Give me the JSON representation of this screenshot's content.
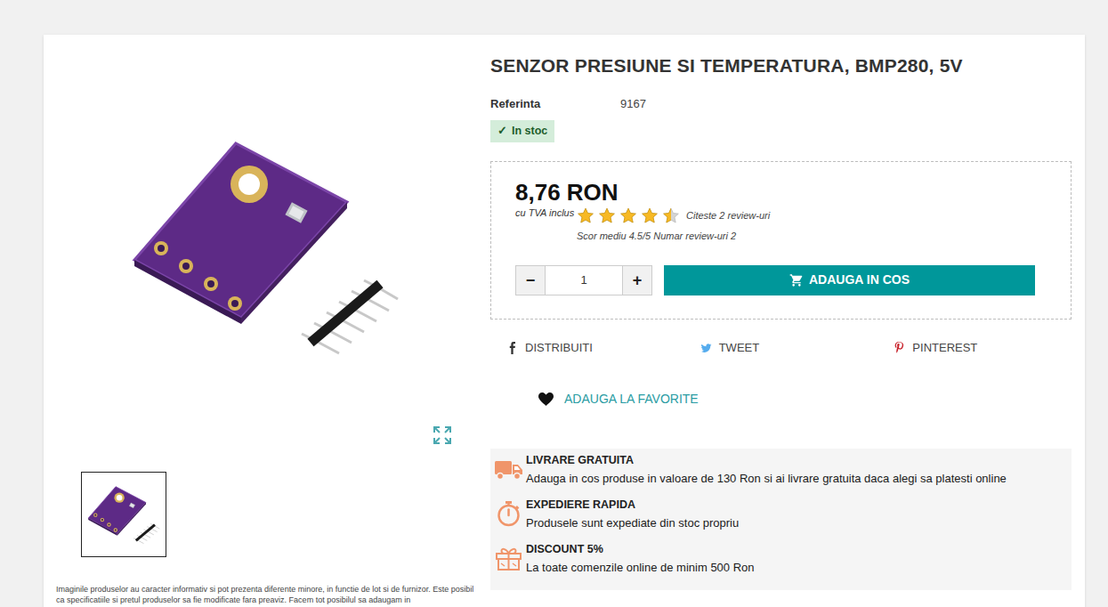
{
  "product": {
    "title": "SENZOR PRESIUNE SI TEMPERATURA, BMP280, 5V",
    "reference_label": "Referinta",
    "reference": "9167",
    "stock": {
      "icon": "✓",
      "label": "In stoc",
      "in_stock": true
    }
  },
  "price": {
    "amount": "8,76 RON",
    "tax_note": "cu TVA inclus"
  },
  "rating": {
    "stars": 4.5,
    "reviews_link": "Citeste 2 review-uri",
    "summary": "Scor mediu 4.5/5 Numar review-uri 2"
  },
  "quantity": {
    "minus": "−",
    "value": "1",
    "plus": "+"
  },
  "add_to_cart": "ADAUGA IN COS",
  "share": [
    {
      "label": "DISTRIBUITI",
      "kind": "facebook"
    },
    {
      "label": "TWEET",
      "kind": "twitter"
    },
    {
      "label": "PINTEREST",
      "kind": "pinterest"
    }
  ],
  "favorite": "ADAUGA LA FAVORITE",
  "benefits": [
    {
      "title": "LIVRARE GRATUITA",
      "text": "Adauga in cos produse in valoare de 130 Ron si ai livrare gratuita daca alegi sa platesti online",
      "kind": "truck"
    },
    {
      "title": "EXPEDIERE RAPIDA",
      "text": "Produsele sunt expediate din stoc propriu",
      "kind": "stopwatch"
    },
    {
      "title": "DISCOUNT 5%",
      "text": "La toate comenzile online de minim 500 Ron",
      "kind": "gift"
    }
  ],
  "gallery": {
    "thumbnails": [
      {
        "selected": true
      }
    ]
  },
  "disclaimer": "Imaginile produselor au caracter informativ si pot prezenta diferente minore, in functie de lot si de furnizor. Este posibil ca specificatiile si pretul produselor sa fie modificate fara preaviz. Facem tot posibilul sa adaugam in"
}
